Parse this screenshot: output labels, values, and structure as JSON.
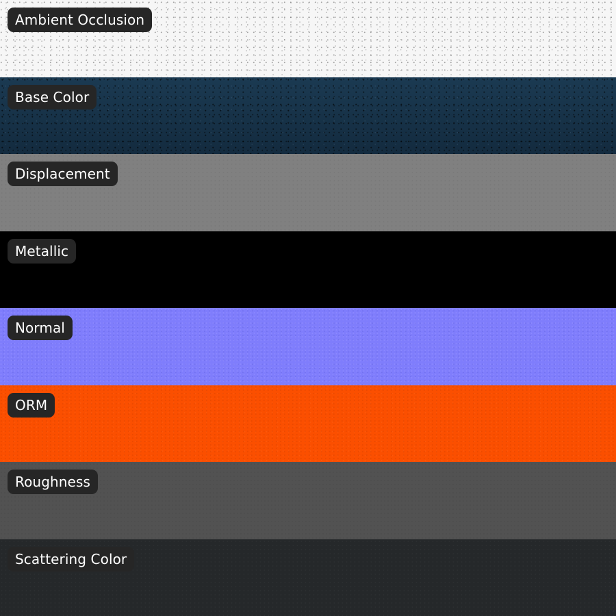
{
  "maps": [
    {
      "label": "Ambient Occlusion",
      "color": "#f6f6f6"
    },
    {
      "label": "Base Color",
      "color": "#173349"
    },
    {
      "label": "Displacement",
      "color": "#808080"
    },
    {
      "label": "Metallic",
      "color": "#000000"
    },
    {
      "label": "Normal",
      "color": "#7f7dfc"
    },
    {
      "label": "ORM",
      "color": "#fb4f00"
    },
    {
      "label": "Roughness",
      "color": "#525252"
    },
    {
      "label": "Scattering Color",
      "color": "#25282a"
    }
  ]
}
